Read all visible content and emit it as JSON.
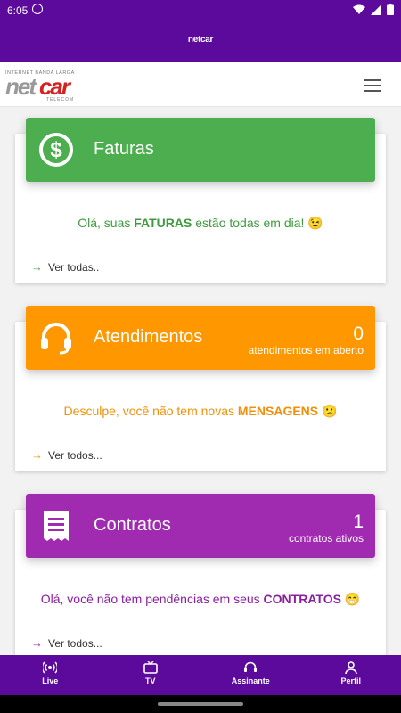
{
  "status_bar": {
    "time": "6:05"
  },
  "app_title": "netcar",
  "logo": {
    "tagline": "INTERNET  BANDA  LARGA",
    "brand_net": "net",
    "brand_car": "car",
    "sub": "TELECOM"
  },
  "cards": [
    {
      "title": "Faturas",
      "color": "#4cae4f",
      "message_pre": "Olá, suas ",
      "message_bold": "FATURAS",
      "message_post": " estão todas em dia! 😉",
      "link": "Ver todas.."
    },
    {
      "title": "Atendimentos",
      "color": "#ff9800",
      "count": "0",
      "count_label": "atendimentos em aberto",
      "message_pre": "Desculpe, você não tem novas ",
      "message_bold": "MENSAGENS",
      "message_post": " 😕",
      "link": "Ver todos..."
    },
    {
      "title": "Contratos",
      "color": "#a02bb0",
      "count": "1",
      "count_label": "contratos ativos",
      "message_pre": "Olá, você não tem pendências em seus ",
      "message_bold": "CONTRATOS",
      "message_post": " 😁",
      "link": "Ver todos..."
    }
  ],
  "bottom_nav": [
    {
      "label": "Live",
      "icon": "broadcast-icon"
    },
    {
      "label": "TV",
      "icon": "tv-icon"
    },
    {
      "label": "Assinante",
      "icon": "headset-icon"
    },
    {
      "label": "Perfil",
      "icon": "person-icon"
    }
  ]
}
